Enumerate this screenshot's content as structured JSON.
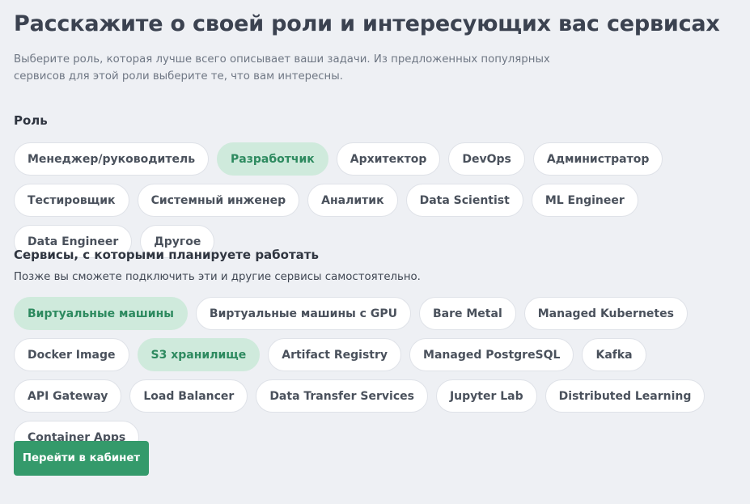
{
  "header": {
    "title": "Расскажите о своей роли и интересующих вас сервисах",
    "description": "Выберите роль, которая лучше всего описывает ваши задачи. Из предложенных популярных сервисов для этой роли выберите те, что вам интересны."
  },
  "roles": {
    "label": "Роль",
    "items": [
      {
        "label": "Менеджер/руководитель",
        "selected": false
      },
      {
        "label": "Разработчик",
        "selected": true
      },
      {
        "label": "Архитектор",
        "selected": false
      },
      {
        "label": "DevOps",
        "selected": false
      },
      {
        "label": "Администратор",
        "selected": false
      },
      {
        "label": "Тестировщик",
        "selected": false
      },
      {
        "label": "Системный инженер",
        "selected": false
      },
      {
        "label": "Аналитик",
        "selected": false
      },
      {
        "label": "Data Scientist",
        "selected": false
      },
      {
        "label": "ML Engineer",
        "selected": false
      },
      {
        "label": "Data Engineer",
        "selected": false
      },
      {
        "label": "Другое",
        "selected": false
      }
    ]
  },
  "services": {
    "label": "Сервисы, с которыми планируете работать",
    "hint": "Позже вы сможете подключить эти и другие сервисы самостоятельно.",
    "items": [
      {
        "label": "Виртуальные машины",
        "selected": true
      },
      {
        "label": "Виртуальные машины с GPU",
        "selected": false
      },
      {
        "label": "Bare Metal",
        "selected": false
      },
      {
        "label": "Managed Kubernetes",
        "selected": false
      },
      {
        "label": "Docker Image",
        "selected": false
      },
      {
        "label": "S3 хранилище",
        "selected": true
      },
      {
        "label": "Artifact Registry",
        "selected": false
      },
      {
        "label": "Managed PostgreSQL",
        "selected": false
      },
      {
        "label": "Kafka",
        "selected": false
      },
      {
        "label": "API Gateway",
        "selected": false
      },
      {
        "label": "Load Balancer",
        "selected": false
      },
      {
        "label": "Data Transfer Services",
        "selected": false
      },
      {
        "label": "Jupyter Lab",
        "selected": false
      },
      {
        "label": "Distributed Learning",
        "selected": false
      },
      {
        "label": "Container Apps",
        "selected": false
      }
    ]
  },
  "submit": {
    "label": "Перейти в кабинет"
  },
  "colors": {
    "accent": "#349a6b",
    "selected_bg": "#cfeadc",
    "selected_text": "#2d8a5f",
    "page_bg": "#eef0f4"
  }
}
